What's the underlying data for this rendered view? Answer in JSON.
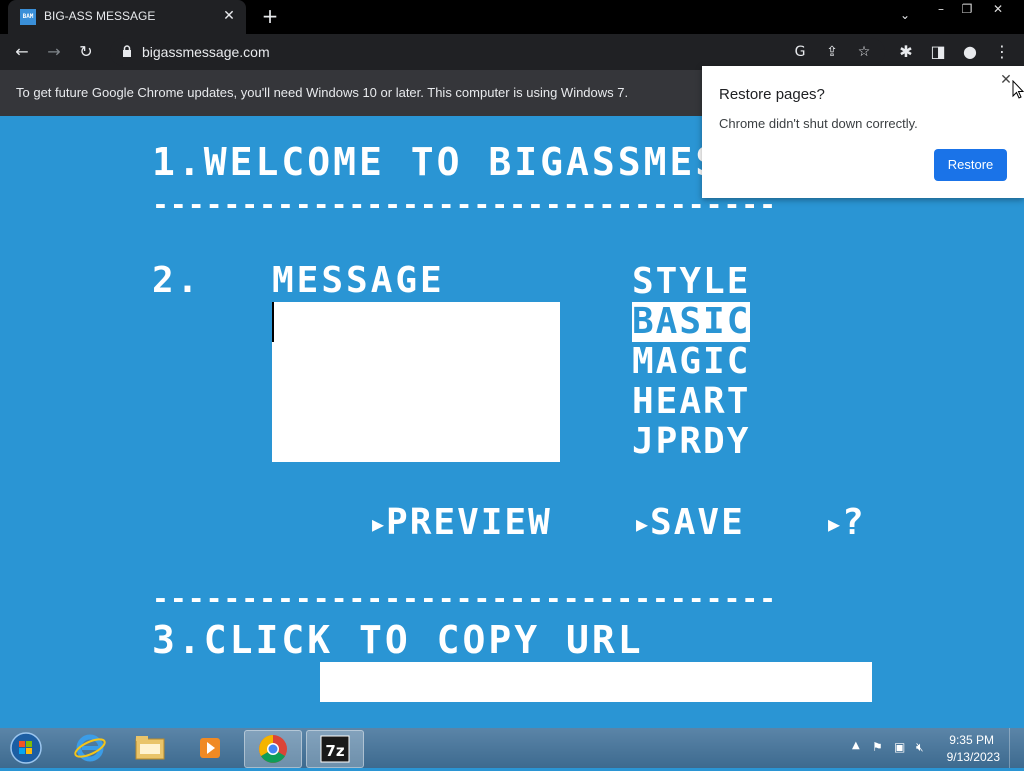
{
  "browser": {
    "tab": {
      "favicon_text": "BAM",
      "title": "BIG-ASS MESSAGE"
    },
    "url": "bigassmessage.com",
    "infobar_text": "To get future Google Chrome updates, you'll need Windows 10 or later. This computer is using Windows 7."
  },
  "page": {
    "step1": "1.WELCOME TO BIGASSMESS",
    "dashes": "-----------------------------------",
    "step2_num": "2.",
    "message_label": "MESSAGE",
    "style_label": "STYLE",
    "style_options": [
      "BASIC",
      "MAGIC",
      "HEART",
      "JPRDY"
    ],
    "selected_style": "BASIC",
    "actions": {
      "preview": "PREVIEW",
      "save": "SAVE",
      "help": "?"
    },
    "step3": "3.CLICK TO COPY URL"
  },
  "popup": {
    "title": "Restore pages?",
    "message": "Chrome didn't shut down correctly.",
    "button": "Restore"
  },
  "taskbar": {
    "time": "9:35 PM",
    "date": "9/13/2023"
  },
  "colors": {
    "page_bg": "#2a95d4",
    "accent": "#1a73e8"
  }
}
